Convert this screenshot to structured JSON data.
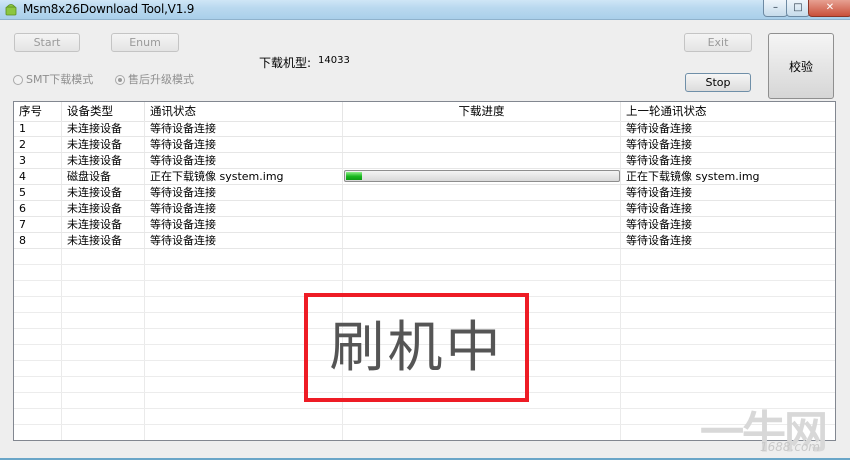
{
  "window": {
    "title": "Msm8x26Download Tool,V1.9",
    "controls": [
      "–",
      "□",
      "✕"
    ]
  },
  "toolbar": {
    "start": "Start",
    "enum": "Enum",
    "exit": "Exit",
    "stop": "Stop",
    "verify": "校验"
  },
  "mode": {
    "smt": "SMT下载模式",
    "after_sale": "售后升级模式",
    "selected": "after_sale"
  },
  "model": {
    "label": "下载机型:",
    "value": "14033"
  },
  "table": {
    "columns": [
      "序号",
      "设备类型",
      "通讯状态",
      "下载进度",
      "上一轮通讯状态"
    ],
    "rows": [
      {
        "no": "1",
        "type": "未连接设备",
        "status": "等待设备连接",
        "progress": null,
        "last": "等待设备连接"
      },
      {
        "no": "2",
        "type": "未连接设备",
        "status": "等待设备连接",
        "progress": null,
        "last": "等待设备连接"
      },
      {
        "no": "3",
        "type": "未连接设备",
        "status": "等待设备连接",
        "progress": null,
        "last": "等待设备连接"
      },
      {
        "no": "4",
        "type": "磁盘设备",
        "status": "正在下载镜像 system.img",
        "progress": 0.06,
        "last": "正在下载镜像 system.img"
      },
      {
        "no": "5",
        "type": "未连接设备",
        "status": "等待设备连接",
        "progress": null,
        "last": "等待设备连接"
      },
      {
        "no": "6",
        "type": "未连接设备",
        "status": "等待设备连接",
        "progress": null,
        "last": "等待设备连接"
      },
      {
        "no": "7",
        "type": "未连接设备",
        "status": "等待设备连接",
        "progress": null,
        "last": "等待设备连接"
      },
      {
        "no": "8",
        "type": "未连接设备",
        "status": "等待设备连接",
        "progress": null,
        "last": "等待设备连接"
      }
    ]
  },
  "overlay": {
    "text": "刷机中",
    "border_color": "#ee1c25"
  },
  "watermark": {
    "glyph": "一牛网",
    "url": "1688.com"
  }
}
